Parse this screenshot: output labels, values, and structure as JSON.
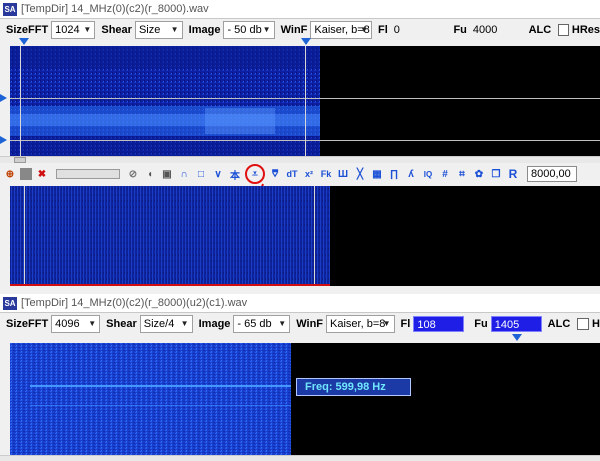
{
  "window1": {
    "title": "[TempDir] 14_MHz(0)(c2)(r_8000).wav",
    "app_icon": "SA",
    "controls": {
      "sizefft_label": "SizeFFT",
      "sizefft_value": "1024",
      "shear_label": "Shear",
      "shear_value": "Size",
      "image_label": "Image",
      "image_value": "- 50 db",
      "winf_label": "WinF",
      "winf_value": "Kaiser, b=8",
      "fl_label": "Fl",
      "fl_value": "0",
      "fu_label": "Fu",
      "fu_value": "4000",
      "alc_label": "ALC",
      "hres_label": "HRes"
    }
  },
  "toolbar": {
    "icons": [
      "zoom-icon",
      "stop-square-icon",
      "cross-out-icon",
      "slider",
      "circle-slash-icon",
      "speaker-icon",
      "frame-icon",
      "arc-up-icon",
      "square-icon",
      "valley-icon",
      "tree-icon",
      "filter-down-icon",
      "filter-up-icon",
      "dt-icon",
      "x-squared-icon",
      "f-sub-icon",
      "comb-icon",
      "cross-icon",
      "grid-icon",
      "bars-icon",
      "lambda-icon",
      "iq-icon",
      "hash-icon",
      "double-hash-icon",
      "gear-icon",
      "copy-icon",
      "r-icon"
    ],
    "tb_labels": {
      "dt": "dT",
      "xsq": "x²",
      "fk": "Fk",
      "r": "R",
      "iq": "IQ"
    },
    "value": "8000,00"
  },
  "window2": {
    "title": "[TempDir] 14_MHz(0)(c2)(r_8000)(u2)(c1).wav",
    "app_icon": "SA",
    "controls": {
      "sizefft_label": "SizeFFT",
      "sizefft_value": "4096",
      "shear_label": "Shear",
      "shear_value": "Size/4",
      "image_label": "Image",
      "image_value": "- 65 db",
      "winf_label": "WinF",
      "winf_value": "Kaiser, b=8",
      "fl_label": "Fl",
      "fl_value": "108",
      "fu_label": "Fu",
      "fu_value": "1405",
      "alc_label": "ALC",
      "hres_label": "H"
    },
    "freq_readout": "Freq: 599,98 Hz"
  },
  "colors": {
    "accent": "#1e63d6",
    "highlight_red": "#e01010",
    "field_blue": "#1e1ee6",
    "spectrum_bg": "#000000"
  }
}
